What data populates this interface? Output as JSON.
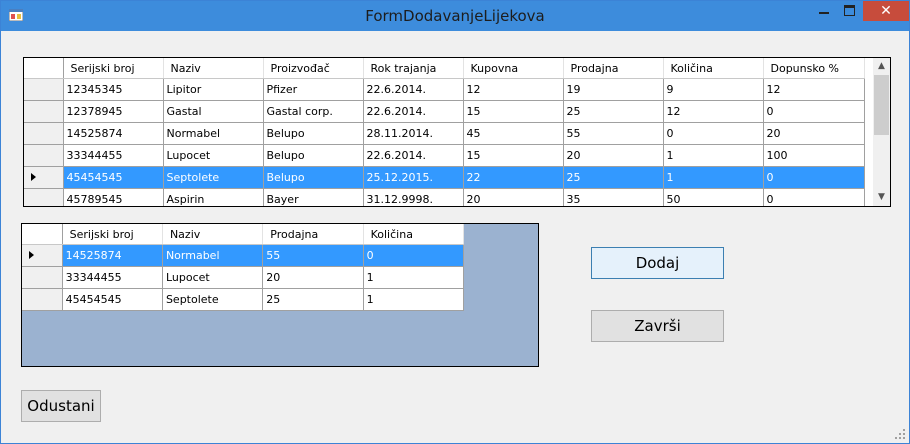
{
  "window": {
    "title": "FormDodavanjeLijekova"
  },
  "grid1": {
    "columns": [
      "Serijski broj",
      "Naziv",
      "Proizvođač",
      "Rok trajanja",
      "Kupovna",
      "Prodajna",
      "Količina",
      "Dopunsko %"
    ],
    "rows": [
      [
        "12345345",
        "Lipitor",
        "Pfizer",
        "22.6.2014.",
        "12",
        "19",
        "9",
        "12"
      ],
      [
        "12378945",
        "Gastal",
        "Gastal corp.",
        "22.6.2014.",
        "15",
        "25",
        "12",
        "0"
      ],
      [
        "14525874",
        "Normabel",
        "Belupo",
        "28.11.2014.",
        "45",
        "55",
        "0",
        "20"
      ],
      [
        "33344455",
        "Lupocet",
        "Belupo",
        "22.6.2014.",
        "15",
        "20",
        "1",
        "100"
      ],
      [
        "45454545",
        "Septolete",
        "Belupo",
        "25.12.2015.",
        "22",
        "25",
        "1",
        "0"
      ],
      [
        "45789545",
        "Aspirin",
        "Bayer",
        "31.12.9998.",
        "20",
        "35",
        "50",
        "0"
      ]
    ],
    "selected_row": 4
  },
  "grid2": {
    "columns": [
      "Serijski broj",
      "Naziv",
      "Prodajna",
      "Količina"
    ],
    "rows": [
      [
        "14525874",
        "Normabel",
        "55",
        "0"
      ],
      [
        "33344455",
        "Lupocet",
        "20",
        "1"
      ],
      [
        "45454545",
        "Septolete",
        "25",
        "1"
      ]
    ],
    "selected_row": 0
  },
  "buttons": {
    "dodaj": "Dodaj",
    "zavrsi": "Završi",
    "odustani": "Odustani"
  },
  "titlebar_buttons": {
    "close": "✕"
  }
}
